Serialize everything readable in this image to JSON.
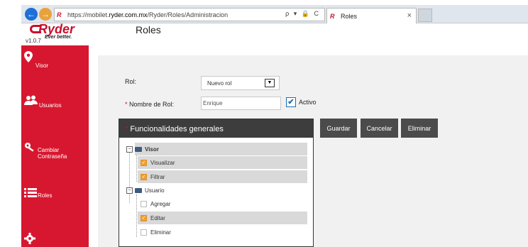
{
  "browser": {
    "url_prefix": "https://mobilet.",
    "url_host": "ryder.com.mx",
    "url_path": "/Ryder/Roles/Administracion",
    "address_tools": "ρ ▾ 🔒 C",
    "tab_title": "Roles",
    "tab_close": "×"
  },
  "header": {
    "logo_name": "Ryder",
    "logo_tagline": "Ever better.",
    "version": "v1.0.7",
    "page_title": "Roles"
  },
  "sidebar": {
    "items": [
      {
        "label": "Visor",
        "icon": "map-pin-icon"
      },
      {
        "label": "Usuarios",
        "icon": "users-icon"
      },
      {
        "label": "Cambiar Contraseña",
        "icon": "key-icon"
      },
      {
        "label": "Roles",
        "icon": "list-icon"
      },
      {
        "label": "",
        "icon": "gear-icon"
      }
    ]
  },
  "form": {
    "rol_label": "Rol:",
    "rol_value": "Nuevo rol",
    "nombre_label": "Nombre de Rol:",
    "nombre_value": "Enrique",
    "activo_label": "Activo",
    "activo_checked": true
  },
  "buttons": {
    "guardar": "Guardar",
    "cancelar": "Cancelar",
    "eliminar": "Eliminar"
  },
  "funcionalidades": {
    "title": "Funcionalidades generales",
    "tree": [
      {
        "label": "Visor",
        "type": "folder",
        "expanded": true,
        "highlight": true
      },
      {
        "label": "Visualizar",
        "type": "leaf",
        "checked": true,
        "highlight": true
      },
      {
        "label": "Filtrar",
        "type": "leaf",
        "checked": true,
        "highlight": true
      },
      {
        "label": "Usuario",
        "type": "folder",
        "expanded": true,
        "highlight": false
      },
      {
        "label": "Agregar",
        "type": "leaf",
        "checked": false,
        "highlight": false
      },
      {
        "label": "Editar",
        "type": "leaf",
        "checked": true,
        "highlight": true
      },
      {
        "label": "Eliminar",
        "type": "leaf",
        "checked": false,
        "highlight": false
      }
    ]
  },
  "colors": {
    "brand_red": "#d7172f",
    "button_dark": "#4b4b4b",
    "checkbox_orange": "#f0a030"
  }
}
